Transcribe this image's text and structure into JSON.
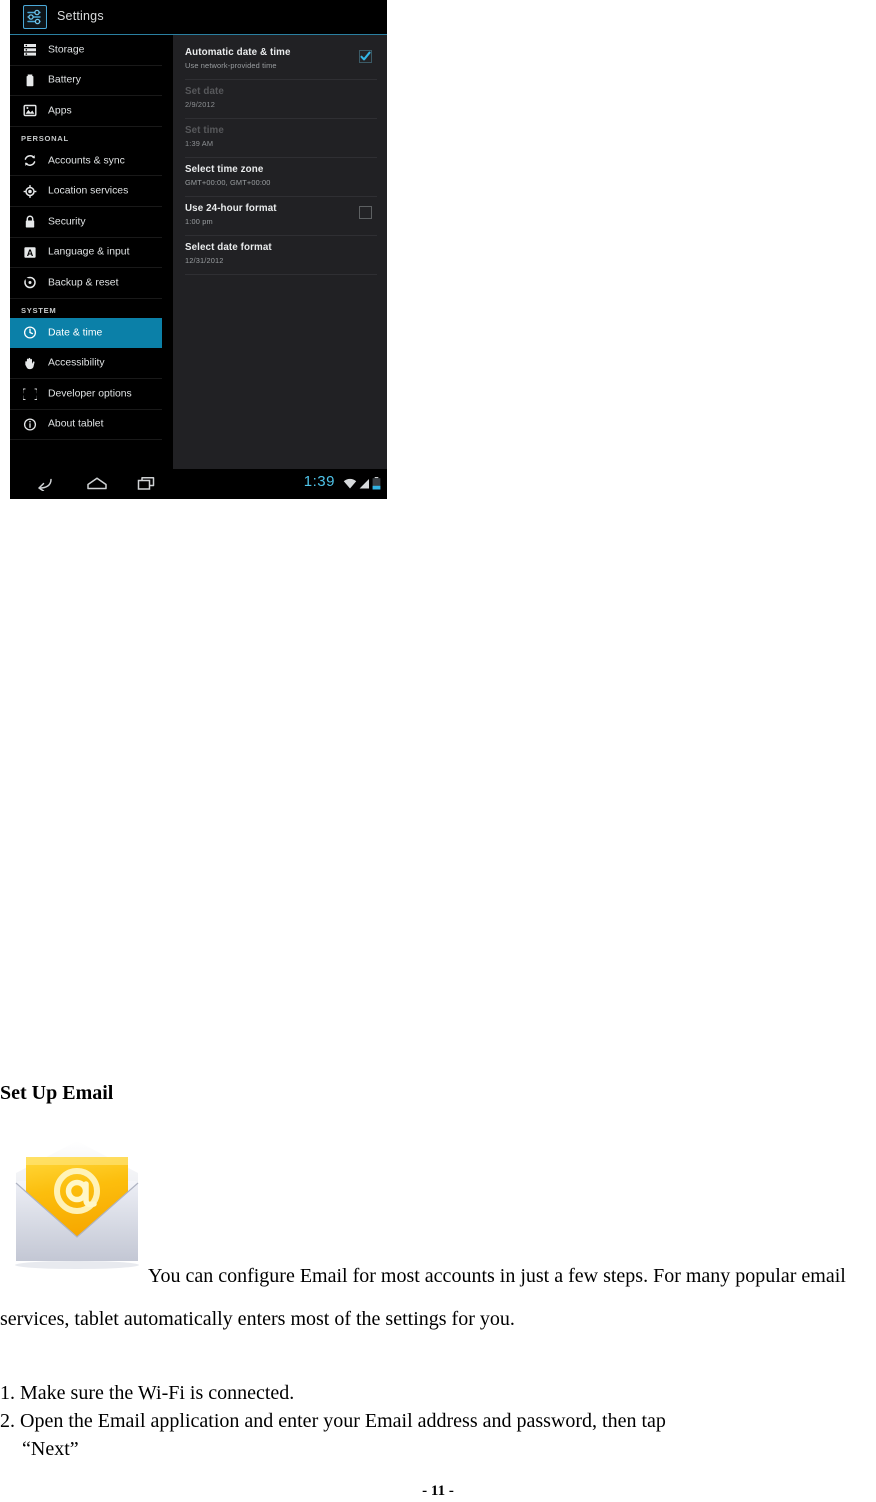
{
  "tablet": {
    "app_title": "Settings",
    "app_icon": "settings-sliders-icon",
    "sidebar": [
      {
        "type": "item",
        "label": "Storage",
        "icon": "storage-icon",
        "selected": false
      },
      {
        "type": "item",
        "label": "Battery",
        "icon": "battery-icon",
        "selected": false
      },
      {
        "type": "item",
        "label": "Apps",
        "icon": "apps-icon",
        "selected": false
      },
      {
        "type": "header",
        "label": "PERSONAL"
      },
      {
        "type": "item",
        "label": "Accounts & sync",
        "icon": "sync-icon",
        "selected": false
      },
      {
        "type": "item",
        "label": "Location services",
        "icon": "location-icon",
        "selected": false
      },
      {
        "type": "item",
        "label": "Security",
        "icon": "lock-icon",
        "selected": false
      },
      {
        "type": "item",
        "label": "Language & input",
        "icon": "language-icon",
        "selected": false
      },
      {
        "type": "item",
        "label": "Backup & reset",
        "icon": "backup-icon",
        "selected": false
      },
      {
        "type": "header",
        "label": "SYSTEM"
      },
      {
        "type": "item",
        "label": "Date & time",
        "icon": "clock-icon",
        "selected": true
      },
      {
        "type": "item",
        "label": "Accessibility",
        "icon": "hand-icon",
        "selected": false
      },
      {
        "type": "item",
        "label": "Developer options",
        "icon": "braces-icon",
        "selected": false
      },
      {
        "type": "item",
        "label": "About tablet",
        "icon": "info-icon",
        "selected": false
      }
    ],
    "preferences": [
      {
        "title": "Automatic date & time",
        "summary": "Use network-provided time",
        "checkbox": "checked",
        "disabled": false
      },
      {
        "title": "Set date",
        "summary": "2/9/2012",
        "checkbox": "none",
        "disabled": true
      },
      {
        "title": "Set time",
        "summary": "1:39 AM",
        "checkbox": "none",
        "disabled": true
      },
      {
        "title": "Select time zone",
        "summary": "GMT+00:00, GMT+00:00",
        "checkbox": "none",
        "disabled": false
      },
      {
        "title": "Use 24-hour format",
        "summary": "1:00 pm",
        "checkbox": "unchecked",
        "disabled": false
      },
      {
        "title": "Select date format",
        "summary": "12/31/2012",
        "checkbox": "none",
        "disabled": false
      }
    ],
    "navbar": {
      "back_icon": "back-arrow-icon",
      "home_icon": "home-icon",
      "recents_icon": "recent-apps-icon",
      "clock": "1:39",
      "wifi_icon": "wifi-icon",
      "signal_icon": "signal-icon",
      "battery_icon": "battery-status-icon"
    },
    "colors": {
      "accent": "#0b80a8",
      "clock_blue": "#4fc3e8",
      "sidebar_bg": "#000000",
      "panel_bg": "#212124"
    }
  },
  "document": {
    "heading": "Set Up Email",
    "email_icon": "email-envelope-at-icon",
    "paragraph": "You can configure Email for most accounts in just a few steps. For many popular email services, tablet automatically enters most of the settings for you.",
    "steps": [
      "1. Make sure the Wi-Fi is connected.",
      "2. Open the Email application and enter your Email address and password, then tap",
      "“Next”"
    ],
    "page_number": "- 11 -"
  }
}
